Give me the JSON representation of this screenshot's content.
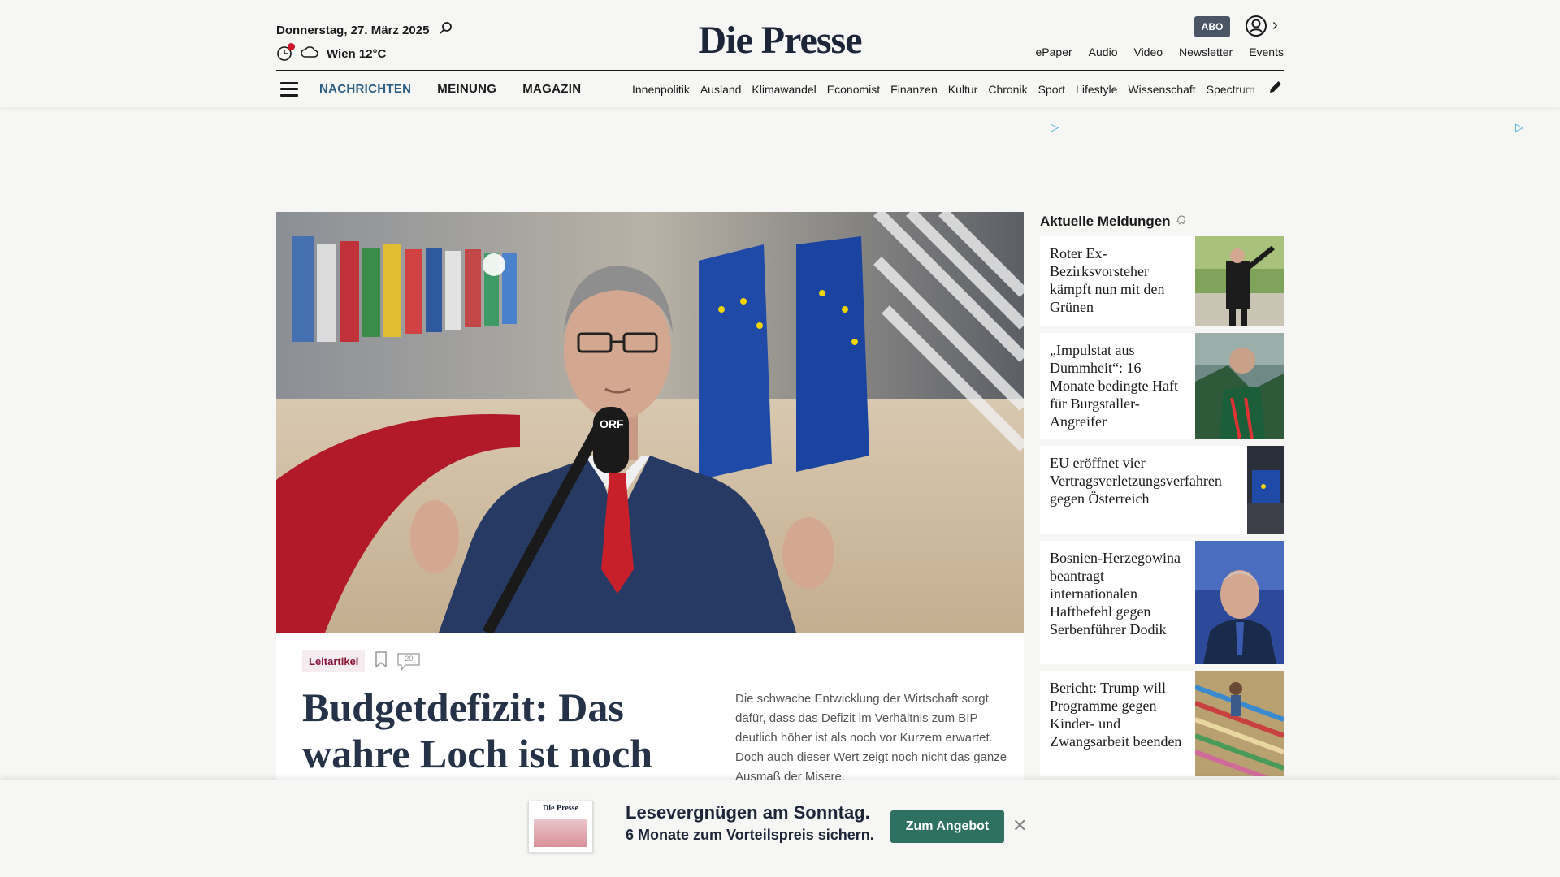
{
  "header": {
    "date": "Donnerstag, 27. März 2025",
    "weather": "Wien 12°C",
    "logo": "Die Presse",
    "abo_label": "ABO",
    "util_links": [
      "ePaper",
      "Audio",
      "Video",
      "Newsletter",
      "Events"
    ]
  },
  "nav": {
    "main": [
      "NACHRICHTEN",
      "MEINUNG",
      "MAGAZIN"
    ],
    "sub": [
      "Innenpolitik",
      "Ausland",
      "Klimawandel",
      "Economist",
      "Finanzen",
      "Kultur",
      "Chronik",
      "Sport",
      "Lifestyle",
      "Wissenschaft",
      "Spectrum"
    ]
  },
  "lead": {
    "tag": "Leitartikel",
    "comment_count": "20",
    "headline": "Budgetdefizit: Das wahre Loch ist noch",
    "teaser": "Die schwache Entwicklung der Wirtschaft sorgt dafür, dass das Defizit im Verhältnis zum BIP deutlich höher ist als noch vor Kurzem erwartet. Doch auch dieser Wert zeigt noch nicht das ganze Ausmaß der Misere."
  },
  "sidebar": {
    "title": "Aktuelle Meldungen",
    "items": [
      {
        "title": "Roter Ex-Bezirksvorsteher kämpft nun mit den Grünen"
      },
      {
        "title": "„Impulstat aus Dummheit“: 16 Monate bedingte Haft für Burgstaller-Angreifer"
      },
      {
        "title": "EU eröffnet vier Vertragsverletzungsverfahren gegen Österreich"
      },
      {
        "title": "Bosnien-Herzegowina beantragt internationalen Haftbefehl gegen Serbenführer Dodik"
      },
      {
        "title": "Bericht: Trump will Programme gegen Kinder- und Zwangsarbeit beenden"
      }
    ]
  },
  "promo": {
    "thumb_logo": "Die Presse",
    "line1": "Lesevergnügen am Sonntag.",
    "line2": "6 Monate zum Vorteilspreis sichern.",
    "button": "Zum Angebot"
  },
  "colors": {
    "nav_active": "#2c5e86",
    "tag_text": "#8a1538",
    "promo_button": "#2e7162",
    "abo_badge": "#4a5565",
    "ad_marker": "#2a9fd6"
  },
  "icons": [
    "search-icon",
    "clock-icon",
    "cloud-icon",
    "user-icon",
    "chevron-right-icon",
    "menu-icon",
    "pencil-icon",
    "bookmark-icon",
    "comment-icon",
    "bell-icon",
    "close-icon",
    "ad-choices-icon"
  ]
}
